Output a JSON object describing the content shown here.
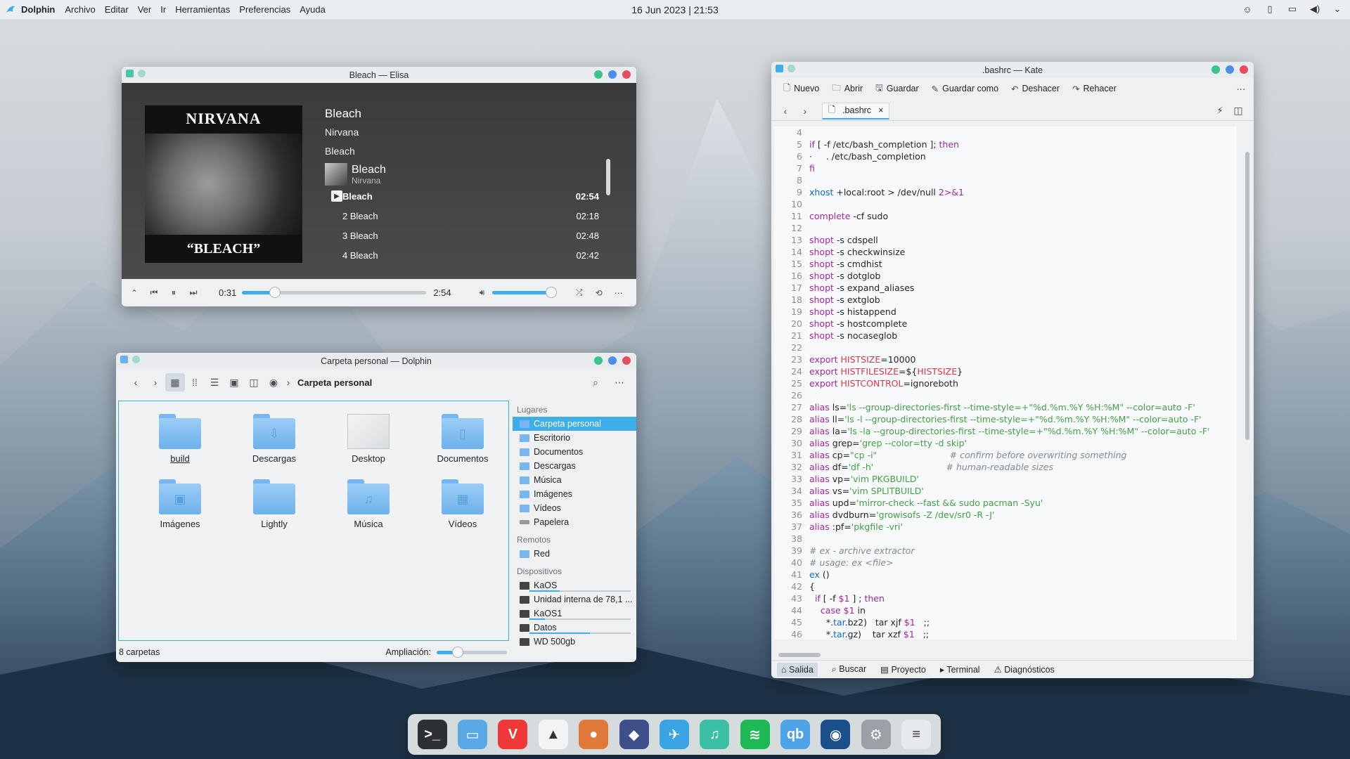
{
  "top_panel": {
    "app_name": "Dolphin",
    "menu": [
      "Archivo",
      "Editar",
      "Ver",
      "Ir",
      "Herramientas",
      "Preferencias",
      "Ayuda"
    ],
    "clock": "16 Jun 2023 | 21:53",
    "tray_icons": [
      "ghost-icon",
      "battery-icon",
      "display-icon",
      "volume-icon",
      "chevron-down-icon"
    ]
  },
  "elisa": {
    "title": "Bleach — Elisa",
    "now_playing": {
      "title": "Bleach",
      "artist": "Nirvana",
      "album": "Bleach"
    },
    "cover": {
      "band": "NIRVANA",
      "album": "“BLEACH”"
    },
    "album_header": {
      "name": "Bleach",
      "artist": "Nirvana"
    },
    "tracks": [
      {
        "label": "Bleach",
        "duration": "02:54"
      },
      {
        "label": "2 Bleach",
        "duration": "02:18"
      },
      {
        "label": "3 Bleach",
        "duration": "02:48"
      },
      {
        "label": "4 Bleach",
        "duration": "02:42"
      }
    ],
    "position": "0:31",
    "length": "2:54",
    "progress": 0.18,
    "volume": 0.94
  },
  "dolphin": {
    "title": "Carpeta personal — Dolphin",
    "breadcrumb": "Carpeta personal",
    "items": [
      {
        "label": "build",
        "glyph": ""
      },
      {
        "label": "Descargas",
        "glyph": "⇩"
      },
      {
        "label": "Desktop",
        "glyph": ""
      },
      {
        "label": "Documentos",
        "glyph": "▯"
      },
      {
        "label": "Imágenes",
        "glyph": "▣"
      },
      {
        "label": "Lightly",
        "glyph": ""
      },
      {
        "label": "Música",
        "glyph": "♫"
      },
      {
        "label": "Vídeos",
        "glyph": "▦"
      }
    ],
    "places_label": "Lugares",
    "places": [
      "Carpeta personal",
      "Escritorio",
      "Documentos",
      "Descargas",
      "Música",
      "Imágenes",
      "Vídeos",
      "Papelera"
    ],
    "remote_label": "Remotos",
    "remote": [
      "Red"
    ],
    "devices_label": "Dispositivos",
    "devices": [
      {
        "label": "KaOS",
        "used": 0.3
      },
      {
        "label": "Unidad interna de 78,1 ...",
        "used": null
      },
      {
        "label": "KaOS1",
        "used": 0.15
      },
      {
        "label": "Datos",
        "used": 0.6
      },
      {
        "label": "WD 500gb",
        "used": null
      }
    ],
    "status": "8 carpetas",
    "zoom_label": "Ampliación:",
    "zoom": 0.3
  },
  "kate": {
    "title": ".bashrc — Kate",
    "toolbar": [
      "Nuevo",
      "Abrir",
      "Guardar",
      "Guardar como",
      "Deshacer",
      "Rehacer"
    ],
    "tab": ".bashrc",
    "first_line": 4,
    "code": [
      "",
      "if [ -f /etc/bash_completion ]; then",
      "·     . /etc/bash_completion",
      "fi",
      "",
      "xhost +local:root > /dev/null 2>&1",
      "",
      "complete -cf sudo",
      "",
      "shopt -s cdspell",
      "shopt -s checkwinsize",
      "shopt -s cmdhist",
      "shopt -s dotglob",
      "shopt -s expand_aliases",
      "shopt -s extglob",
      "shopt -s histappend",
      "shopt -s hostcomplete",
      "shopt -s nocaseglob",
      "",
      "export HISTSIZE=10000",
      "export HISTFILESIZE=${HISTSIZE}",
      "export HISTCONTROL=ignoreboth",
      "",
      "alias ls='ls --group-directories-first --time-style=+\"%d.%m.%Y %H:%M\" --color=auto -F'",
      "alias ll='ls -l --group-directories-first --time-style=+\"%d.%m.%Y %H:%M\" --color=auto -F'",
      "alias la='ls -la --group-directories-first --time-style=+\"%d.%m.%Y %H:%M\" --color=auto -F'",
      "alias grep='grep --color=tty -d skip'",
      "alias cp=\"cp -i\"                          # confirm before overwriting something",
      "alias df='df -h'                          # human-readable sizes",
      "alias vp='vim PKGBUILD'",
      "alias vs='vim SPLITBUILD'",
      "alias upd='mirror-check --fast && sudo pacman -Syu'",
      "alias dvdburn='growisofs -Z /dev/sr0 -R -J'",
      "alias :pf='pkgfile -vri'",
      "",
      "# ex - archive extractor",
      "# usage: ex <file>",
      "ex ()",
      "{",
      "  if [ -f $1 ] ; then",
      "    case $1 in",
      "      *.tar.bz2)   tar xjf $1   ;;",
      "      *.tar.gz)    tar xzf $1   ;;"
    ],
    "bottom": [
      "Salida",
      "Buscar",
      "Proyecto",
      "Terminal",
      "Diagnósticos"
    ]
  },
  "dock": [
    {
      "name": "terminal",
      "bg": "#2e3134",
      "glyph": ">_"
    },
    {
      "name": "dolphin",
      "bg": "#5aa9e6",
      "glyph": "▭"
    },
    {
      "name": "vivaldi",
      "bg": "#ef3939",
      "glyph": "V"
    },
    {
      "name": "inkscape",
      "bg": "#f3f3f3",
      "glyph": "▲"
    },
    {
      "name": "gimp",
      "bg": "#e07a3a",
      "glyph": "●"
    },
    {
      "name": "kdenlive",
      "bg": "#3f4f8a",
      "glyph": "◆"
    },
    {
      "name": "kaos",
      "bg": "#3aa3e3",
      "glyph": "✈"
    },
    {
      "name": "elisa",
      "bg": "#3cc0a5",
      "glyph": "♫"
    },
    {
      "name": "spotify",
      "bg": "#1db954",
      "glyph": "≋"
    },
    {
      "name": "qbittorrent",
      "bg": "#4da3e6",
      "glyph": "qb"
    },
    {
      "name": "steam",
      "bg": "#1b4f8a",
      "glyph": "◉"
    },
    {
      "name": "settings",
      "bg": "#9aa0a6",
      "glyph": "⚙"
    },
    {
      "name": "task-manager",
      "bg": "#e7eaed",
      "glyph": "≡"
    }
  ]
}
